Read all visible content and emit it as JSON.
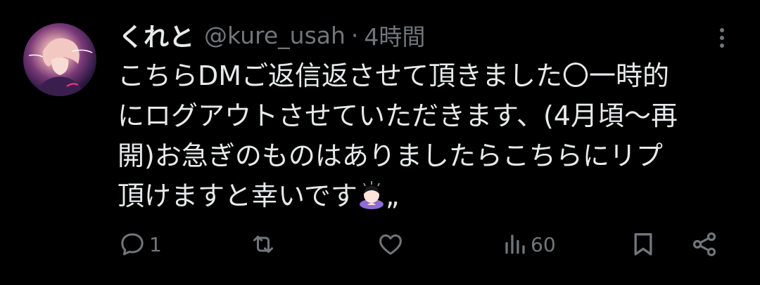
{
  "tweet": {
    "display_name": "くれと",
    "handle": "@kure_usah",
    "separator": "·",
    "time": "4時間",
    "text_lines": [
      "こちらDMご返信返させて頂きました〇一時的",
      "にログアウトさせていただきます、(4月頃〜再",
      "開)お急ぎのものはありましたらこちらにリプ",
      "頂けますと幸いです"
    ],
    "text_suffix": "„",
    "emoji": "person-bowing-emoji"
  },
  "actions": {
    "reply_count": "1",
    "retweet_count": "",
    "like_count": "",
    "views_count": "60"
  },
  "colors": {
    "background": "#000000",
    "primary_text": "#e7e9ea",
    "secondary_text": "#71767b"
  }
}
